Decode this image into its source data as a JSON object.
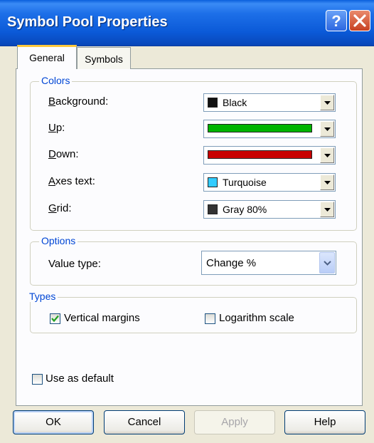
{
  "window": {
    "title": "Symbol Pool Properties",
    "help_icon": "help-question-icon",
    "close_icon": "close-x-icon"
  },
  "tabs": [
    {
      "label": "General",
      "active": true
    },
    {
      "label": "Symbols",
      "active": false
    }
  ],
  "colors_group": {
    "title": "Colors",
    "rows": [
      {
        "label_u": "B",
        "label_rest": "ackground:",
        "value": "Black",
        "swatch": "#111111",
        "style": "named"
      },
      {
        "label_u": "U",
        "label_rest": "p:",
        "value": "",
        "swatch": "#00b400",
        "style": "bar"
      },
      {
        "label_u": "D",
        "label_rest": "own:",
        "value": "",
        "swatch": "#c80000",
        "style": "bar"
      },
      {
        "label_u": "A",
        "label_rest": "xes text:",
        "value": "Turquoise",
        "swatch": "#33ccff",
        "style": "named"
      },
      {
        "label_u": "G",
        "label_rest": "rid:",
        "value": "Gray 80%",
        "swatch": "#333333",
        "style": "named"
      }
    ]
  },
  "options_group": {
    "title": "Options",
    "value_type_label": "Value type:",
    "value_type_selected": "Change %"
  },
  "types_group": {
    "title": "Types",
    "vertical_margins": {
      "label": "Vertical margins",
      "checked": true
    },
    "logarithm_scale": {
      "label": "Logarithm scale",
      "checked": false
    }
  },
  "use_as_default": {
    "label": "Use as default",
    "checked": false
  },
  "buttons": {
    "ok": "OK",
    "cancel": "Cancel",
    "apply": "Apply",
    "help": "Help"
  },
  "accent_colors": {
    "title_bar": "#0b5ad8",
    "group_title": "#0046d5",
    "active_tab_highlight": "#ffc83c"
  }
}
